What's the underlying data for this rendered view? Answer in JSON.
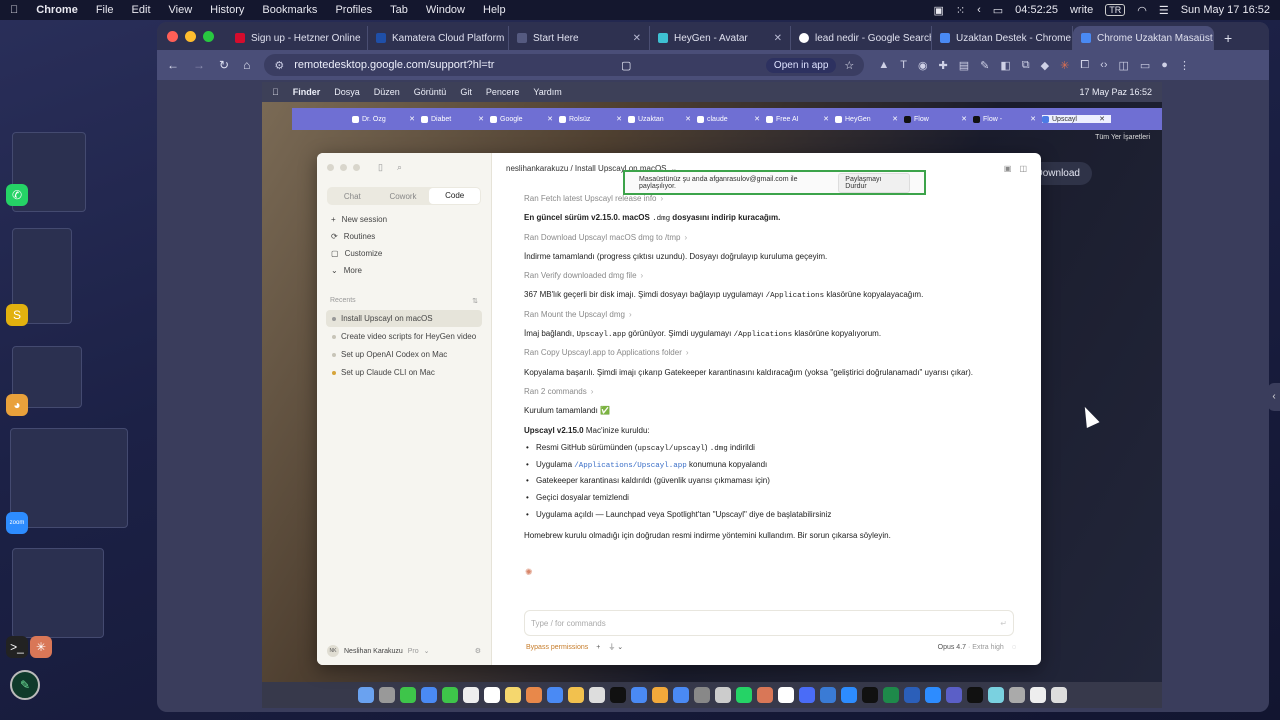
{
  "host_menubar": {
    "app": "Chrome",
    "items": [
      "File",
      "Edit",
      "View",
      "History",
      "Bookmarks",
      "Profiles",
      "Tab",
      "Window",
      "Help"
    ],
    "timer": "04:52:25",
    "mode": "write",
    "lang": "TR",
    "datetime": "Sun May 17 16:52"
  },
  "chrome": {
    "tabs": [
      {
        "label": "Sign up - Hetzner Online",
        "color": "#d50c2d"
      },
      {
        "label": "Kamatera Cloud Platform",
        "color": "#1f4fa8"
      },
      {
        "label": "Start Here",
        "color": "#555a80"
      },
      {
        "label": "HeyGen - Avatar",
        "color": "#3ec1d3"
      },
      {
        "label": "lead nedir - Google Search",
        "color": "#ffffff"
      },
      {
        "label": "Uzaktan Destek - Chrome",
        "color": "#4a8af4"
      },
      {
        "label": "Chrome Uzaktan Masaüstü",
        "color": "#4a8af4"
      }
    ],
    "url": "remotedesktop.google.com/support?hl=tr",
    "open_in_app": "Open in app"
  },
  "remote": {
    "menubar": {
      "app": "Finder",
      "items": [
        "Dosya",
        "Düzen",
        "Görüntü",
        "Git",
        "Pencere",
        "Yardım"
      ],
      "datetime": "17 May Paz  16:52"
    },
    "browser_tabs": [
      "Dr. Özg",
      "Diabet",
      "Google",
      "Rolsüz",
      "Uzaktan",
      "claude",
      "Free AI",
      "HeyGen",
      "Flow",
      "Flow -",
      "Upscayl"
    ],
    "download_label": "Download",
    "bookmarks_label": "Tüm Yer İşaretleri"
  },
  "share_banner": {
    "text": "Masaüstünüz şu anda afganrasulov@gmail.com ile paylaşılıyor.",
    "stop": "Paylaşmayı Durdur"
  },
  "claude": {
    "modes": [
      "Chat",
      "Cowork",
      "Code"
    ],
    "nav": [
      "New session",
      "Routines",
      "Customize",
      "More"
    ],
    "recents_label": "Recents",
    "recents": [
      "Install Upscayl on macOS",
      "Create video scripts for HeyGen video",
      "Set up OpenAI Codex on Mac",
      "Set up Claude CLI on Mac"
    ],
    "user": {
      "initials": "NK",
      "name": "Neslihan Karakuzu",
      "plan": "Pro"
    },
    "breadcrumb": "neslihankarakuzu / Install Upscayl on macOS",
    "messages": {
      "fetch": "Ran Fetch latest Upscayl release info",
      "version_a": "En güncel sürüm v2.15.0. macOS ",
      "version_code": ".dmg",
      "version_b": " dosyasını indirip kuracağım.",
      "download": "Ran Download Upscayl macOS dmg to /tmp",
      "download_done": "İndirme tamamlandı (progress çıktısı uzundu). Dosyayı doğrulayıp kuruluma geçeyim.",
      "verify": "Ran Verify downloaded dmg file",
      "verify_a": "367 MB'lık geçerli bir disk imajı. Şimdi dosyayı bağlayıp uygulamayı ",
      "verify_code": "/Applications",
      "verify_b": " klasörüne kopyalayacağım.",
      "mount": "Ran Mount the Upscayl dmg",
      "mount_a": "İmaj bağlandı, ",
      "mount_code1": "Upscayl.app",
      "mount_b": " görünüyor. Şimdi uygulamayı ",
      "mount_code2": "/Applications",
      "mount_c": " klasörüne kopyalıyorum.",
      "copy": "Ran Copy Upscayl.app to Applications folder",
      "copy_done": "Kopyalama başarılı. Şimdi imajı çıkarıp Gatekeeper karantinasını kaldıracağım (yoksa \"geliştirici doğrulanamadı\" uyarısı çıkar).",
      "ran2": "Ran 2 commands",
      "install_done": "Kurulum tamamlandı ✅",
      "summary_title": "Upscayl v2.15.0",
      "summary_rest": " Mac'inize kuruldu:",
      "b1_a": "Resmi GitHub sürümünden (",
      "b1_code": "upscayl/upscayl",
      "b1_b": ") ",
      "b1_code2": ".dmg",
      "b1_c": " indirildi",
      "b2_a": "Uygulama ",
      "b2_code": "/Applications/Upscayl.app",
      "b2_b": " konumuna kopyalandı",
      "b3": "Gatekeeper karantinası kaldırıldı (güvenlik uyarısı çıkmaması için)",
      "b4": "Geçici dosyalar temizlendi",
      "b5": "Uygulama açıldı — Launchpad veya Spotlight'tan \"Upscayl\" diye de başlatabilirsiniz",
      "footer": "Homebrew kurulu olmadığı için doğrudan resmi indirme yöntemini kullandım. Bir sorun çıkarsa söyleyin."
    },
    "composer_placeholder": "Type / for commands",
    "permission_mode": "Bypass permissions",
    "model": "Opus 4.7",
    "effort": "Extra high"
  }
}
